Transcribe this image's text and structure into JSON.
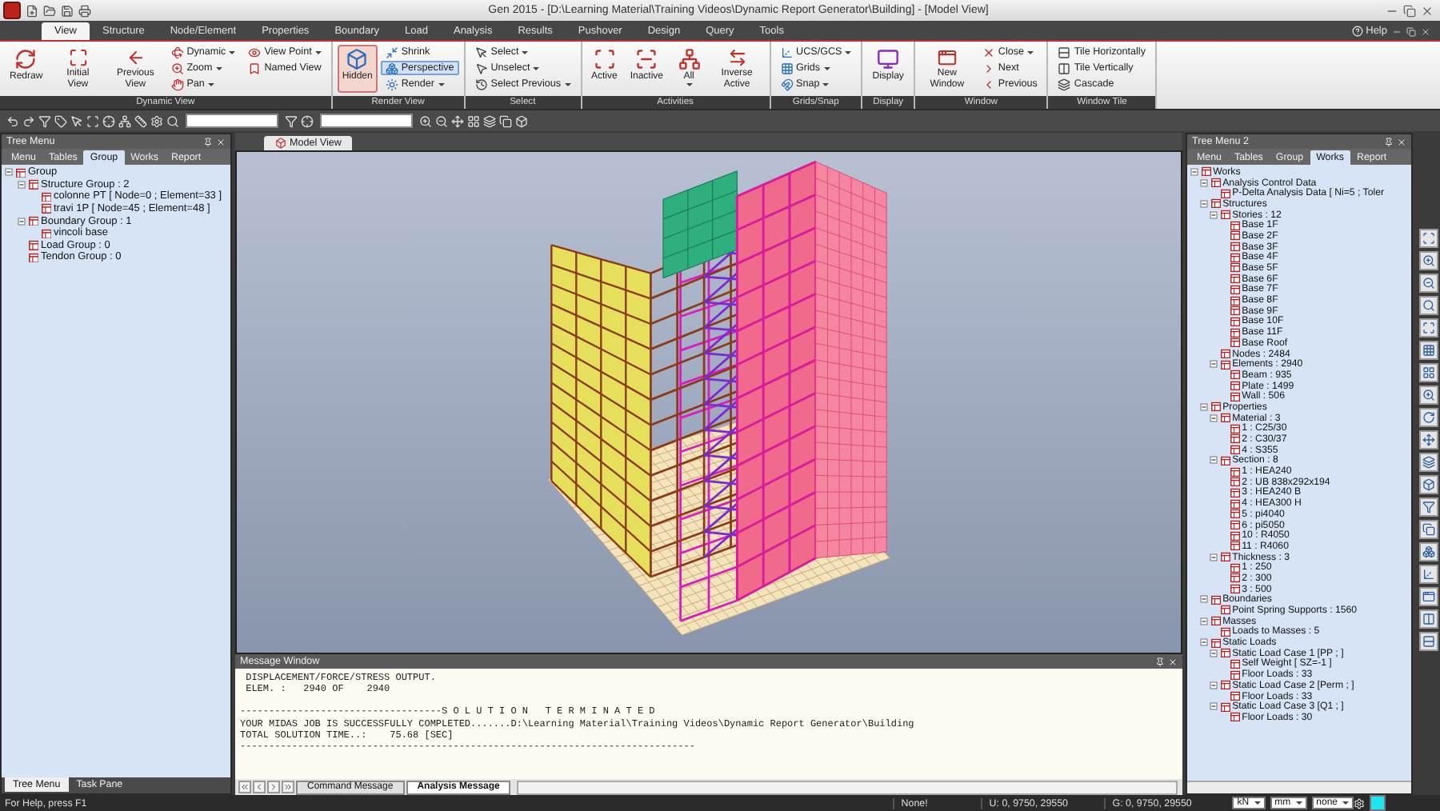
{
  "title_bar": {
    "title": "Gen 2015 - [D:\\Learning Material\\Training Videos\\Dynamic Report Generator\\Building] - [Model View]"
  },
  "menu_tabs": [
    {
      "label": "View",
      "selected": true
    },
    {
      "label": "Structure",
      "selected": false
    },
    {
      "label": "Node/Element",
      "selected": false
    },
    {
      "label": "Properties",
      "selected": false
    },
    {
      "label": "Boundary",
      "selected": false
    },
    {
      "label": "Load",
      "selected": false
    },
    {
      "label": "Analysis",
      "selected": false
    },
    {
      "label": "Results",
      "selected": false
    },
    {
      "label": "Pushover",
      "selected": false
    },
    {
      "label": "Design",
      "selected": false
    },
    {
      "label": "Query",
      "selected": false
    },
    {
      "label": "Tools",
      "selected": false
    }
  ],
  "help": {
    "label": "Help"
  },
  "ribbon": [
    {
      "label": "Dynamic View",
      "items": [
        {
          "label": "Redraw",
          "kind": "large"
        },
        {
          "label": "Initial View",
          "kind": "large"
        },
        {
          "label": "Previous View",
          "kind": "large"
        },
        {
          "label": "Dynamic",
          "kind": "small",
          "dropdown": true
        },
        {
          "label": "Zoom",
          "kind": "small",
          "dropdown": true
        },
        {
          "label": "Pan",
          "kind": "small",
          "dropdown": true
        },
        {
          "label": "View Point",
          "kind": "small",
          "dropdown": true
        },
        {
          "label": "Named View",
          "kind": "small"
        }
      ]
    },
    {
      "label": "Render View",
      "items": [
        {
          "label": "Hidden",
          "kind": "large",
          "selected": true
        },
        {
          "label": "Shrink",
          "kind": "small",
          "selected": false
        },
        {
          "label": "Perspective",
          "kind": "small",
          "selected": true
        },
        {
          "label": "Render",
          "kind": "small",
          "dropdown": true,
          "selected": false
        }
      ]
    },
    {
      "label": "Select",
      "items": [
        {
          "label": "Select",
          "kind": "small",
          "dropdown": true
        },
        {
          "label": "Unselect",
          "kind": "small",
          "dropdown": true
        },
        {
          "label": "Select Previous",
          "kind": "small",
          "dropdown": true
        }
      ]
    },
    {
      "label": "Activities",
      "items": [
        {
          "label": "Active",
          "kind": "large"
        },
        {
          "label": "Inactive",
          "kind": "large"
        },
        {
          "label": "All",
          "kind": "large",
          "dropdown": true
        },
        {
          "label": "Inverse Active",
          "kind": "large"
        }
      ]
    },
    {
      "label": "Grids/Snap",
      "items": [
        {
          "label": "UCS/GCS",
          "kind": "small",
          "dropdown": true
        },
        {
          "label": "Grids",
          "kind": "small",
          "dropdown": true
        },
        {
          "label": "Snap",
          "kind": "small",
          "dropdown": true
        }
      ]
    },
    {
      "label": "Display",
      "items": [
        {
          "label": "Display",
          "kind": "large"
        }
      ]
    },
    {
      "label": "Window",
      "items": [
        {
          "label": "New Window",
          "kind": "large"
        },
        {
          "label": "Close",
          "kind": "small",
          "dropdown": true
        },
        {
          "label": "Next",
          "kind": "small"
        },
        {
          "label": "Previous",
          "kind": "small"
        }
      ]
    },
    {
      "label": "Window Tile",
      "items": [
        {
          "label": "Tile Horizontally",
          "kind": "small"
        },
        {
          "label": "Tile Vertically",
          "kind": "small"
        },
        {
          "label": "Cascade",
          "kind": "small"
        }
      ]
    }
  ],
  "left_panel": {
    "title": "Tree Menu",
    "tabs": [
      {
        "label": "Menu",
        "selected": false
      },
      {
        "label": "Tables",
        "selected": false
      },
      {
        "label": "Group",
        "selected": true
      },
      {
        "label": "Works",
        "selected": false
      },
      {
        "label": "Report",
        "selected": false
      }
    ],
    "tree": [
      {
        "label": "Group",
        "children": [
          {
            "label": "Structure Group : 2",
            "children": [
              {
                "label": "colonne PT [ Node=0 ; Element=33 ]"
              },
              {
                "label": "travi 1P [ Node=45 ; Element=48 ]"
              }
            ]
          },
          {
            "label": "Boundary Group : 1",
            "children": [
              {
                "label": "vincoli base"
              }
            ]
          },
          {
            "label": "Load Group : 0"
          },
          {
            "label": "Tendon Group : 0"
          }
        ]
      }
    ],
    "bottom_tabs": [
      {
        "label": "Tree Menu",
        "selected": true
      },
      {
        "label": "Task Pane",
        "selected": false
      }
    ]
  },
  "model_view": {
    "tab": "Model View"
  },
  "message_window": {
    "title": "Message Window",
    "lines": [
      " DISPLACEMENT/FORCE/STRESS OUTPUT.",
      " ELEM. :   2940 OF    2940",
      "-----------------------------------S O L U T I O N   T E R M I N A T E D",
      "YOUR MIDAS JOB IS SUCCESSFULLY COMPLETED.......D:\\Learning Material\\Training Videos\\Dynamic Report Generator\\Building",
      "TOTAL SOLUTION TIME..:    75.68 [SEC]",
      "-------------------------------------------------------------------------------"
    ],
    "tabs": [
      {
        "label": "Command Message",
        "selected": false
      },
      {
        "label": "Analysis Message",
        "selected": true
      }
    ]
  },
  "right_panel": {
    "title": "Tree Menu 2",
    "tabs": [
      {
        "label": "Menu",
        "selected": false
      },
      {
        "label": "Tables",
        "selected": false
      },
      {
        "label": "Group",
        "selected": false
      },
      {
        "label": "Works",
        "selected": true
      },
      {
        "label": "Report",
        "selected": false
      }
    ],
    "tree": [
      {
        "label": "Works",
        "children": [
          {
            "label": "Analysis Control Data",
            "children": [
              {
                "label": "P-Delta Analysis Data [ Ni=5 ; Toler"
              }
            ]
          },
          {
            "label": "Structures",
            "children": [
              {
                "label": "Stories : 12",
                "children": [
                  {
                    "label": "Base 1F"
                  },
                  {
                    "label": "Base 2F"
                  },
                  {
                    "label": "Base 3F"
                  },
                  {
                    "label": "Base 4F"
                  },
                  {
                    "label": "Base 5F"
                  },
                  {
                    "label": "Base 6F"
                  },
                  {
                    "label": "Base 7F"
                  },
                  {
                    "label": "Base 8F"
                  },
                  {
                    "label": "Base 9F"
                  },
                  {
                    "label": "Base 10F"
                  },
                  {
                    "label": "Base 11F"
                  },
                  {
                    "label": "Base Roof"
                  }
                ]
              },
              {
                "label": "Nodes : 2484"
              },
              {
                "label": "Elements : 2940",
                "children": [
                  {
                    "label": "Beam : 935"
                  },
                  {
                    "label": "Plate : 1499"
                  },
                  {
                    "label": "Wall : 506"
                  }
                ]
              }
            ]
          },
          {
            "label": "Properties",
            "children": [
              {
                "label": "Material : 3",
                "children": [
                  {
                    "label": "1 : C25/30"
                  },
                  {
                    "label": "2 : C30/37"
                  },
                  {
                    "label": "4 : S355"
                  }
                ]
              },
              {
                "label": "Section : 8",
                "children": [
                  {
                    "label": "1 : HEA240"
                  },
                  {
                    "label": "2 : UB 838x292x194"
                  },
                  {
                    "label": "3 : HEA240 B"
                  },
                  {
                    "label": "4 : HEA300 H"
                  },
                  {
                    "label": "5 : pi4040"
                  },
                  {
                    "label": "6 : pi5050"
                  },
                  {
                    "label": "10 : R4050"
                  },
                  {
                    "label": "11 : R4060"
                  }
                ]
              },
              {
                "label": "Thickness : 3",
                "children": [
                  {
                    "label": "1 : 250"
                  },
                  {
                    "label": "2 : 300"
                  },
                  {
                    "label": "3 : 500"
                  }
                ]
              }
            ]
          },
          {
            "label": "Boundaries",
            "children": [
              {
                "label": "Point Spring Supports : 1560"
              }
            ]
          },
          {
            "label": "Masses",
            "children": [
              {
                "label": "Loads to Masses : 5"
              }
            ]
          },
          {
            "label": "Static Loads",
            "children": [
              {
                "label": "Static Load Case 1 [PP ; ]",
                "children": [
                  {
                    "label": "Self Weight [ SZ=-1 ]"
                  },
                  {
                    "label": "Floor Loads : 33"
                  }
                ]
              },
              {
                "label": "Static Load Case 2 [Perm ; ]",
                "children": [
                  {
                    "label": "Floor Loads : 33"
                  }
                ]
              },
              {
                "label": "Static Load Case 3 [Q1 ; ]",
                "children": [
                  {
                    "label": "Floor Loads : 30"
                  }
                ]
              }
            ]
          }
        ]
      }
    ]
  },
  "status_bar": {
    "help": "For Help, press F1",
    "message": "None!",
    "u_coords": "U: 0, 9750, 29550",
    "g_coords": "G: 0, 9750, 29550",
    "force_unit": "kN",
    "length_unit": "mm",
    "filter": "none"
  }
}
